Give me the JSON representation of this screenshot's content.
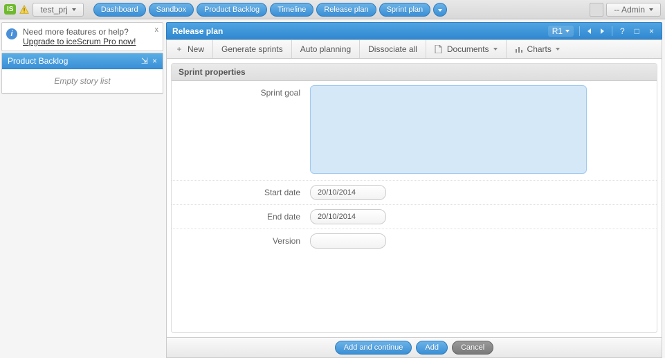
{
  "topbar": {
    "logo_text": "IS",
    "project_label": "test_prj",
    "nav": [
      "Dashboard",
      "Sandbox",
      "Product Backlog",
      "Timeline",
      "Release plan",
      "Sprint plan"
    ],
    "admin_label": "-- Admin"
  },
  "info_banner": {
    "line1": "Need more features or help?",
    "link": "Upgrade to iceScrum Pro now!",
    "close": "x"
  },
  "left_panel": {
    "title": "Product Backlog",
    "body_text": "Empty story list"
  },
  "release_window": {
    "title": "Release plan",
    "release_badge": "R1",
    "toolbar": {
      "new": "New",
      "generate_sprints": "Generate sprints",
      "auto_planning": "Auto planning",
      "dissociate_all": "Dissociate all",
      "documents": "Documents",
      "charts": "Charts"
    },
    "form": {
      "heading": "Sprint properties",
      "labels": {
        "sprint_goal": "Sprint goal",
        "start_date": "Start date",
        "end_date": "End date",
        "version": "Version"
      },
      "values": {
        "sprint_goal": "",
        "start_date": "20/10/2014",
        "end_date": "20/10/2014",
        "version": ""
      }
    },
    "footer": {
      "add_continue": "Add and continue",
      "add": "Add",
      "cancel": "Cancel"
    }
  }
}
